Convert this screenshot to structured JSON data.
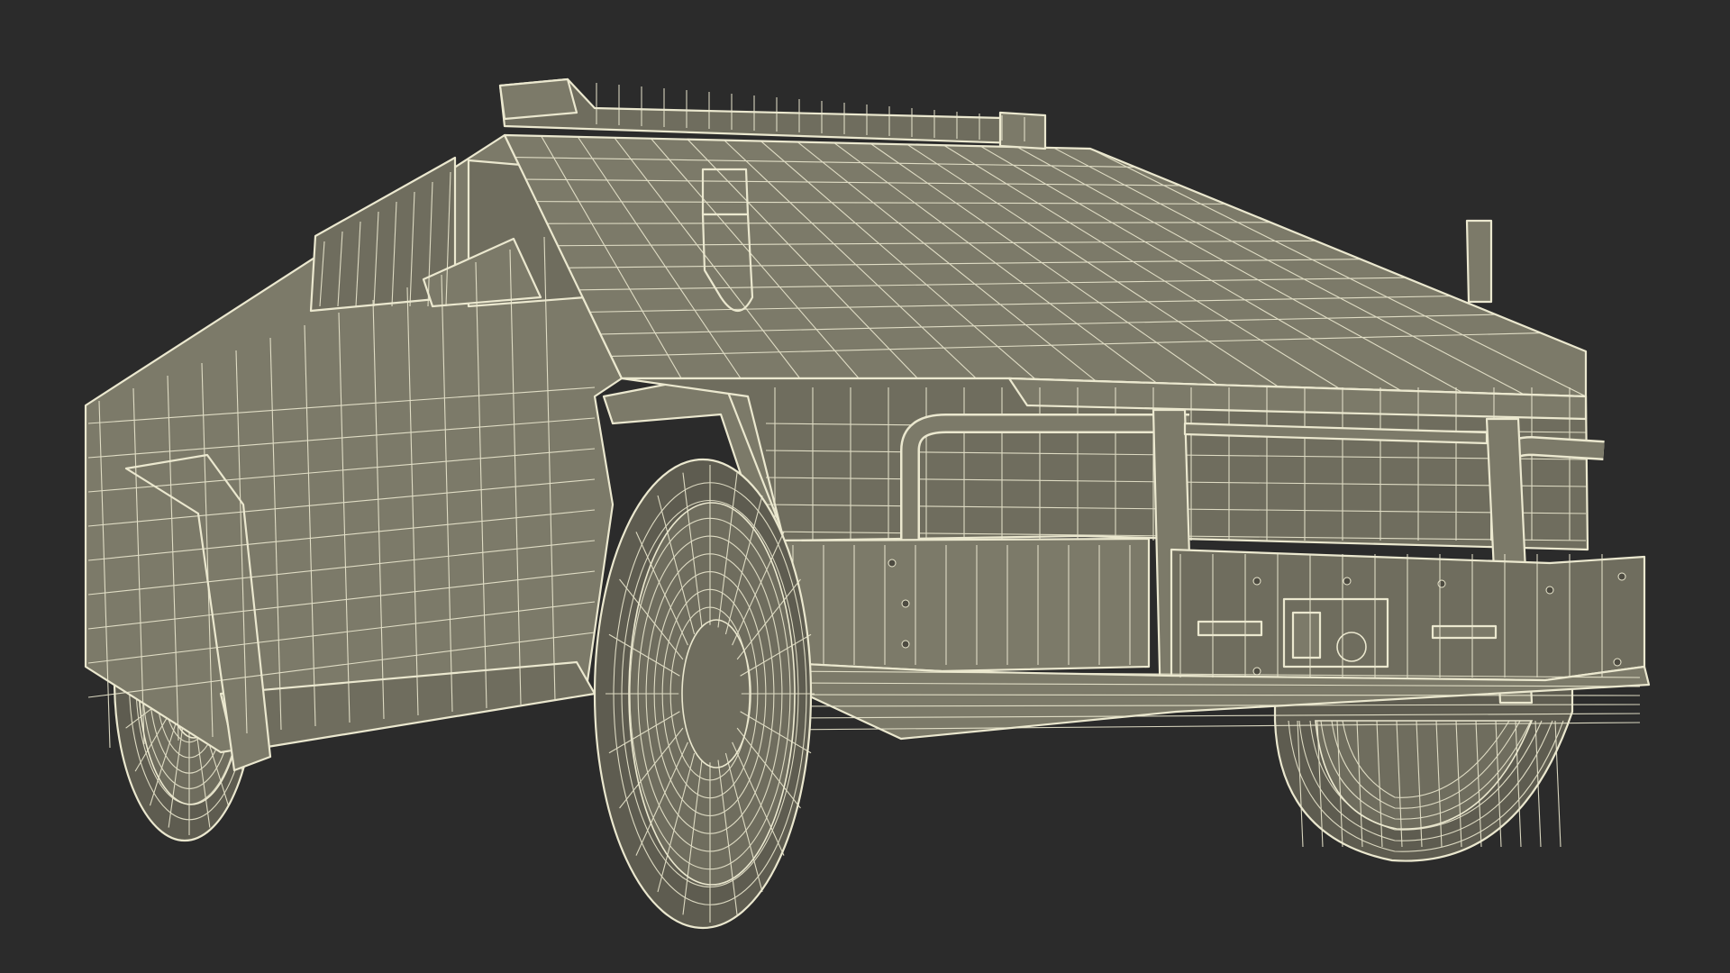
{
  "scene": {
    "subject": "",
    "render_style": "wireframe",
    "colors": {
      "background": "#2b2b2b",
      "surface": "#7c7a69",
      "surface_shade": "#6f6d5e",
      "wire": "#ebe8cf",
      "tire": "#5e5c50"
    }
  }
}
